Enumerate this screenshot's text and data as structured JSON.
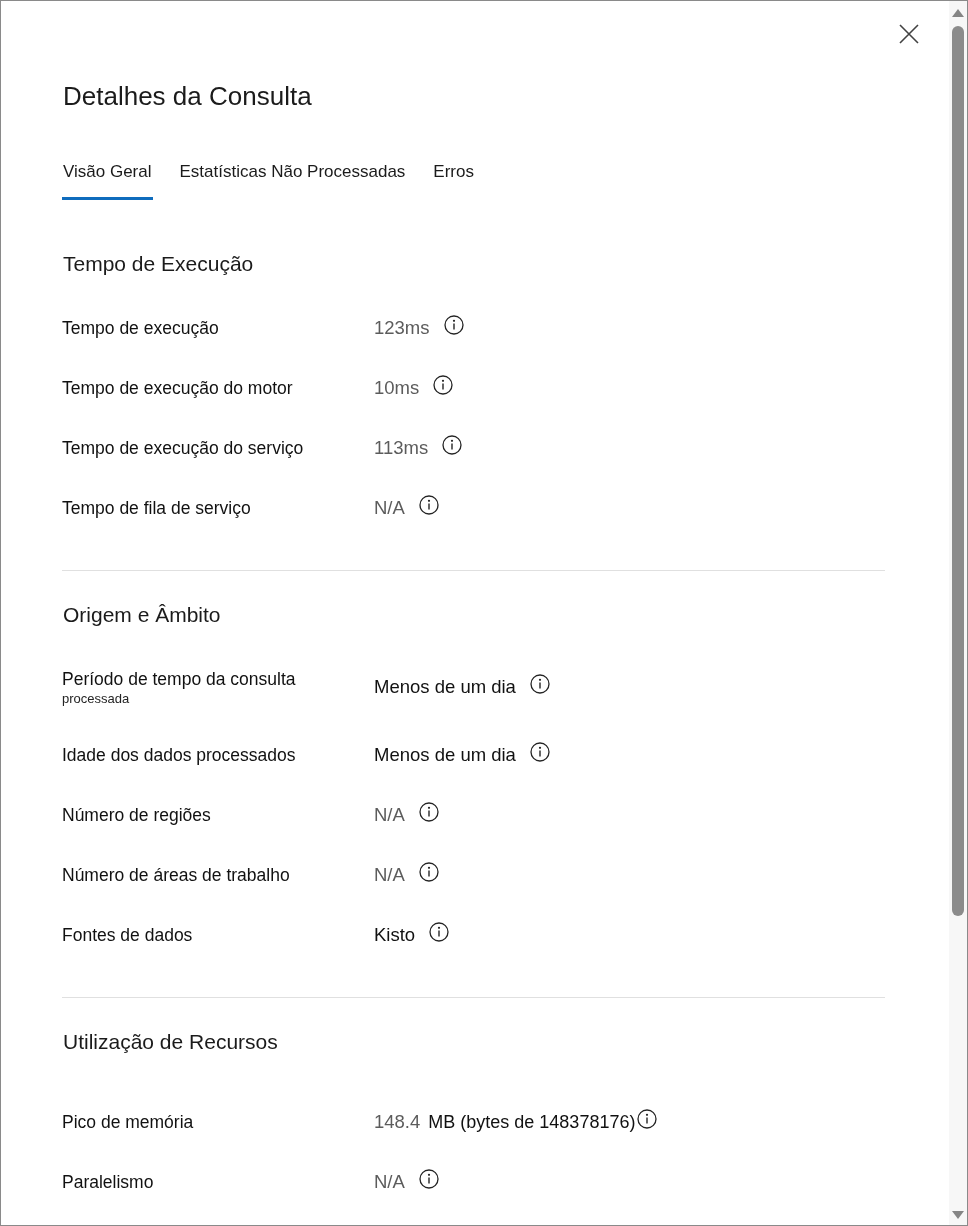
{
  "dialog": {
    "title": "Detalhes da Consulta"
  },
  "tabs": [
    {
      "label": "Visão Geral",
      "selected": true
    },
    {
      "label": "Estatísticas Não Processadas",
      "selected": false
    },
    {
      "label": "Erros",
      "selected": false
    }
  ],
  "sections": [
    {
      "title": "Tempo de Execução",
      "rows": [
        {
          "label": "Tempo de execução",
          "value": "123ms",
          "muted": true
        },
        {
          "label": "Tempo de execução do motor",
          "value": "10ms",
          "muted": true
        },
        {
          "label": "Tempo de execução do serviço",
          "value": "113ms",
          "muted": true
        },
        {
          "label": "Tempo de fila de serviço",
          "value": "N/A",
          "muted": true
        }
      ]
    },
    {
      "title": "Origem e Âmbito",
      "rows": [
        {
          "label": "Período de tempo da consulta",
          "note": "processada",
          "value": "Menos de um dia",
          "muted": false
        },
        {
          "label": "Idade dos dados processados",
          "value": "Menos de um dia",
          "muted": false
        },
        {
          "label": "Número de regiões",
          "value": "N/A",
          "muted": true
        },
        {
          "label": "Número de áreas de trabalho",
          "value": "N/A",
          "muted": true
        },
        {
          "label": "Fontes de dados",
          "value": "Kisto",
          "muted": false
        }
      ]
    },
    {
      "title": "Utilização de Recursos",
      "rows": [
        {
          "label": "Pico de memória",
          "value": "148.4",
          "muted": true,
          "suffix": "MB (bytes de 148378176)"
        },
        {
          "label": "Paralelismo",
          "value": "N/A",
          "muted": true
        }
      ]
    }
  ]
}
